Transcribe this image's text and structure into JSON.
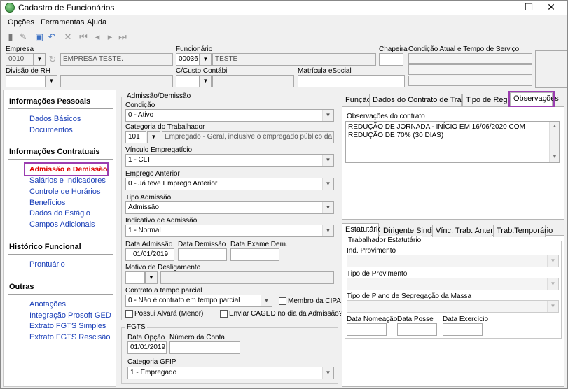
{
  "window": {
    "title": "Cadastro de Funcionários",
    "min": "—",
    "max": "☐",
    "close": "✕"
  },
  "menu": {
    "opcoes": "Opções",
    "ferramentas": "Ferramentas",
    "ajuda": "Ajuda"
  },
  "header": {
    "empresa_label": "Empresa",
    "empresa_code": "0010",
    "empresa_name": "EMPRESA TESTE.",
    "funcionario_label": "Funcionário",
    "funcionario_code": "00036",
    "funcionario_name": "TESTE",
    "chapeira_label": "Chapeira",
    "condicao_label": "Condição Atual e Tempo de Serviço",
    "divisao_label": "Divisão de RH",
    "ccusto_label": "C/Custo Contábil",
    "matricula_label": "Matrícula eSocial"
  },
  "sidebar": {
    "sections": [
      {
        "title": "Informações Pessoais",
        "items": [
          "Dados Básicos",
          "Documentos"
        ]
      },
      {
        "title": "Informações Contratuais",
        "items": [
          "Admissão e Demissão",
          "Salários e Indicadores",
          "Controle de Horários",
          "Benefícios",
          "Dados do Estágio",
          "Campos Adicionais"
        ]
      },
      {
        "title": "Histórico Funcional",
        "items": [
          "Prontuário"
        ]
      },
      {
        "title": "Outras",
        "items": [
          "Anotações",
          "Integração Prosoft GED",
          "Extrato FGTS Simples",
          "Extrato FGTS Rescisão"
        ]
      }
    ]
  },
  "admissao": {
    "group_title": "Admissão/Demissão",
    "condicao_label": "Condição",
    "condicao_value": "0 - Ativo",
    "categoria_label": "Categoria do Trabalhador",
    "categoria_code": "101",
    "categoria_desc": "Empregado - Geral, inclusive o empregado público da administ",
    "vinculo_label": "Vínculo Empregatício",
    "vinculo_value": "1 - CLT",
    "emprego_label": "Emprego Anterior",
    "emprego_value": "0 - Já teve Emprego Anterior",
    "tipo_label": "Tipo Admissão",
    "tipo_value": "Admissão",
    "indicativo_label": "Indicativo de Admissão",
    "indicativo_value": "1 - Normal",
    "data_adm_label": "Data Admissão",
    "data_adm_value": "01/01/2019",
    "data_dem_label": "Data Demissão",
    "data_exame_label": "Data Exame Dem.",
    "motivo_label": "Motivo de Desligamento",
    "parcial_label": "Contrato a tempo parcial",
    "parcial_value": "0 - Não é contrato em tempo parcial",
    "cipa_label": "Membro da CIPA",
    "alvara_label": "Possui Alvará (Menor)",
    "caged_label": "Enviar CAGED no dia da Admissão?"
  },
  "fgts": {
    "group_title": "FGTS",
    "data_label": "Data Opção",
    "data_value": "01/01/2019",
    "conta_label": "Número da Conta",
    "categoria_label": "Categoria GFIP",
    "categoria_value": "1 - Empregado"
  },
  "tabs_top": {
    "items": [
      "Função",
      "Dados do Contrato de Trabalho",
      "Tipo de Regime",
      "Observações"
    ],
    "obs_label": "Observações do contrato",
    "obs_text": "REDUÇÃO DE JORNADA - INÍCIO EM 16/06/2020 COM REDUÇÃO DE 70% (30 DIAS)"
  },
  "tabs_bottom": {
    "items": [
      "Estatutário",
      "Dirigente Sindical",
      "Vínc. Trab. Anterior",
      "Trab.Temporário"
    ],
    "group_title": "Trabalhador Estatutário",
    "ind_label": "Ind. Provimento",
    "tipo_label": "Tipo de Provimento",
    "plano_label": "Tipo de Plano de Segregação da Massa",
    "nomeacao_label": "Data Nomeação",
    "posse_label": "Data Posse",
    "exercicio_label": "Data Exercício"
  },
  "colors": {
    "link": "#1a3fb8",
    "selected": "#e00000",
    "highlight": "#9b3db0"
  }
}
